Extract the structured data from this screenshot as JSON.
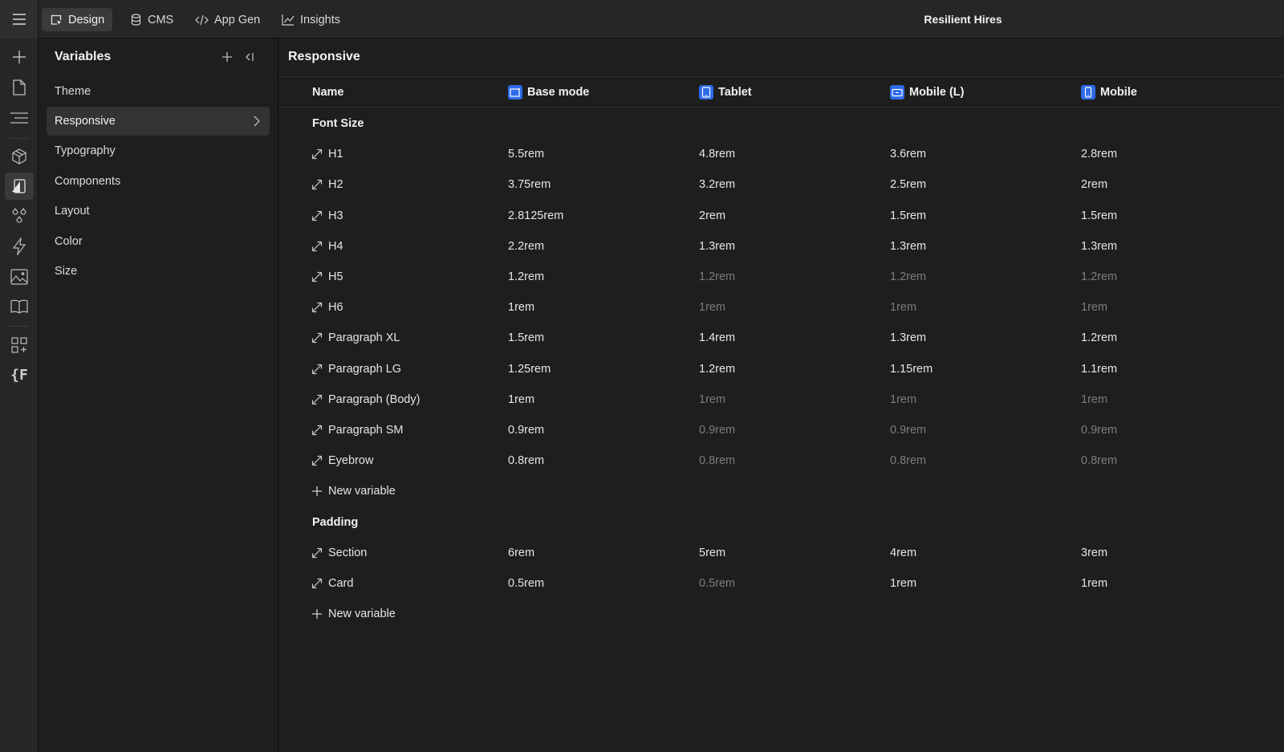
{
  "topbar": {
    "tabs": [
      {
        "label": "Design",
        "icon": "cursor-square-icon",
        "active": true
      },
      {
        "label": "CMS",
        "icon": "database-icon",
        "active": false
      },
      {
        "label": "App Gen",
        "icon": "code-icon",
        "active": false
      },
      {
        "label": "Insights",
        "icon": "chart-line-icon",
        "active": false
      }
    ],
    "project_title": "Resilient Hires"
  },
  "rail": {
    "icons": [
      "add-icon",
      "page-icon",
      "navigator-icon",
      "components-cube-icon",
      "variables-icon",
      "styles-drops-icon",
      "interactions-bolt-icon",
      "assets-image-icon",
      "library-book-icon",
      "apps-grid-icon",
      "figma-plugin-icon"
    ],
    "active": "variables-icon"
  },
  "panel": {
    "title": "Variables",
    "collections": [
      "Theme",
      "Responsive",
      "Typography",
      "Components",
      "Layout",
      "Color",
      "Size"
    ],
    "active_collection": "Responsive"
  },
  "table": {
    "title": "Responsive",
    "columns": {
      "name": "Name",
      "modes": [
        {
          "label": "Base mode",
          "icon": "desktop-star-icon"
        },
        {
          "label": "Tablet",
          "icon": "tablet-icon"
        },
        {
          "label": "Mobile (L)",
          "icon": "mobile-landscape-icon"
        },
        {
          "label": "Mobile",
          "icon": "mobile-portrait-icon"
        }
      ]
    },
    "groups": [
      {
        "label": "Font Size",
        "new_variable_label": "New variable",
        "rows": [
          {
            "name": "H1",
            "values": [
              "5.5rem",
              "4.8rem",
              "3.6rem",
              "2.8rem"
            ],
            "inherited": [
              false,
              false,
              false,
              false
            ]
          },
          {
            "name": "H2",
            "values": [
              "3.75rem",
              "3.2rem",
              "2.5rem",
              "2rem"
            ],
            "inherited": [
              false,
              false,
              false,
              false
            ]
          },
          {
            "name": "H3",
            "values": [
              "2.8125rem",
              "2rem",
              "1.5rem",
              "1.5rem"
            ],
            "inherited": [
              false,
              false,
              false,
              false
            ]
          },
          {
            "name": "H4",
            "values": [
              "2.2rem",
              "1.3rem",
              "1.3rem",
              "1.3rem"
            ],
            "inherited": [
              false,
              false,
              false,
              false
            ]
          },
          {
            "name": "H5",
            "values": [
              "1.2rem",
              "1.2rem",
              "1.2rem",
              "1.2rem"
            ],
            "inherited": [
              false,
              true,
              true,
              true
            ]
          },
          {
            "name": "H6",
            "values": [
              "1rem",
              "1rem",
              "1rem",
              "1rem"
            ],
            "inherited": [
              false,
              true,
              true,
              true
            ]
          },
          {
            "name": "Paragraph XL",
            "values": [
              "1.5rem",
              "1.4rem",
              "1.3rem",
              "1.2rem"
            ],
            "inherited": [
              false,
              false,
              false,
              false
            ]
          },
          {
            "name": "Paragraph LG",
            "values": [
              "1.25rem",
              "1.2rem",
              "1.15rem",
              "1.1rem"
            ],
            "inherited": [
              false,
              false,
              false,
              false
            ]
          },
          {
            "name": "Paragraph (Body)",
            "values": [
              "1rem",
              "1rem",
              "1rem",
              "1rem"
            ],
            "inherited": [
              false,
              true,
              true,
              true
            ]
          },
          {
            "name": "Paragraph SM",
            "values": [
              "0.9rem",
              "0.9rem",
              "0.9rem",
              "0.9rem"
            ],
            "inherited": [
              false,
              true,
              true,
              true
            ]
          },
          {
            "name": "Eyebrow",
            "values": [
              "0.8rem",
              "0.8rem",
              "0.8rem",
              "0.8rem"
            ],
            "inherited": [
              false,
              true,
              true,
              true
            ]
          }
        ]
      },
      {
        "label": "Padding",
        "new_variable_label": "New variable",
        "rows": [
          {
            "name": "Section",
            "values": [
              "6rem",
              "5rem",
              "4rem",
              "3rem"
            ],
            "inherited": [
              false,
              false,
              false,
              false
            ]
          },
          {
            "name": "Card",
            "values": [
              "0.5rem",
              "0.5rem",
              "1rem",
              "1rem"
            ],
            "inherited": [
              false,
              true,
              false,
              false
            ]
          }
        ]
      }
    ]
  }
}
